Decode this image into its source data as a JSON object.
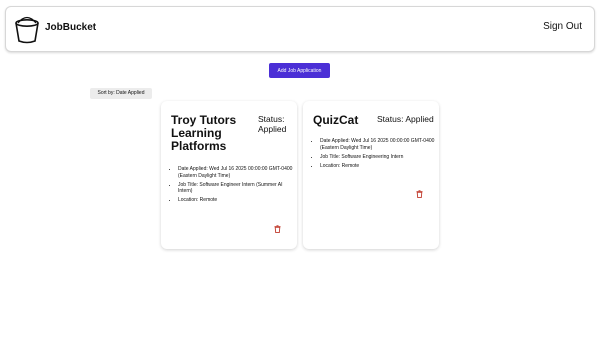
{
  "header": {
    "app_name": "JobBucket",
    "sign_out_label": "Sign Out"
  },
  "actions": {
    "add_label": "Add Job Application",
    "sort_label": "Sort by: Date Applied"
  },
  "applications": [
    {
      "company": "Troy Tutors Learning Platforms",
      "status": "Status: Applied",
      "date_applied": "Date Applied: Wed Jul 16 2025 00:00:00 GMT-0400 (Eastern Daylight Time)",
      "job_title": "Job Title: Software Engineer Intern (Summer AI Intern)",
      "location": "Location: Remote"
    },
    {
      "company": "QuizCat",
      "status": "Status: Applied",
      "date_applied": "Date Applied: Wed Jul 16 2025 00:00:00 GMT-0400 (Eastern Daylight Time)",
      "job_title": "Job Title: Software Engineering Intern",
      "location": "Location: Remote"
    }
  ],
  "colors": {
    "accent": "#4b2fd6",
    "delete_icon": "#c0392b"
  }
}
